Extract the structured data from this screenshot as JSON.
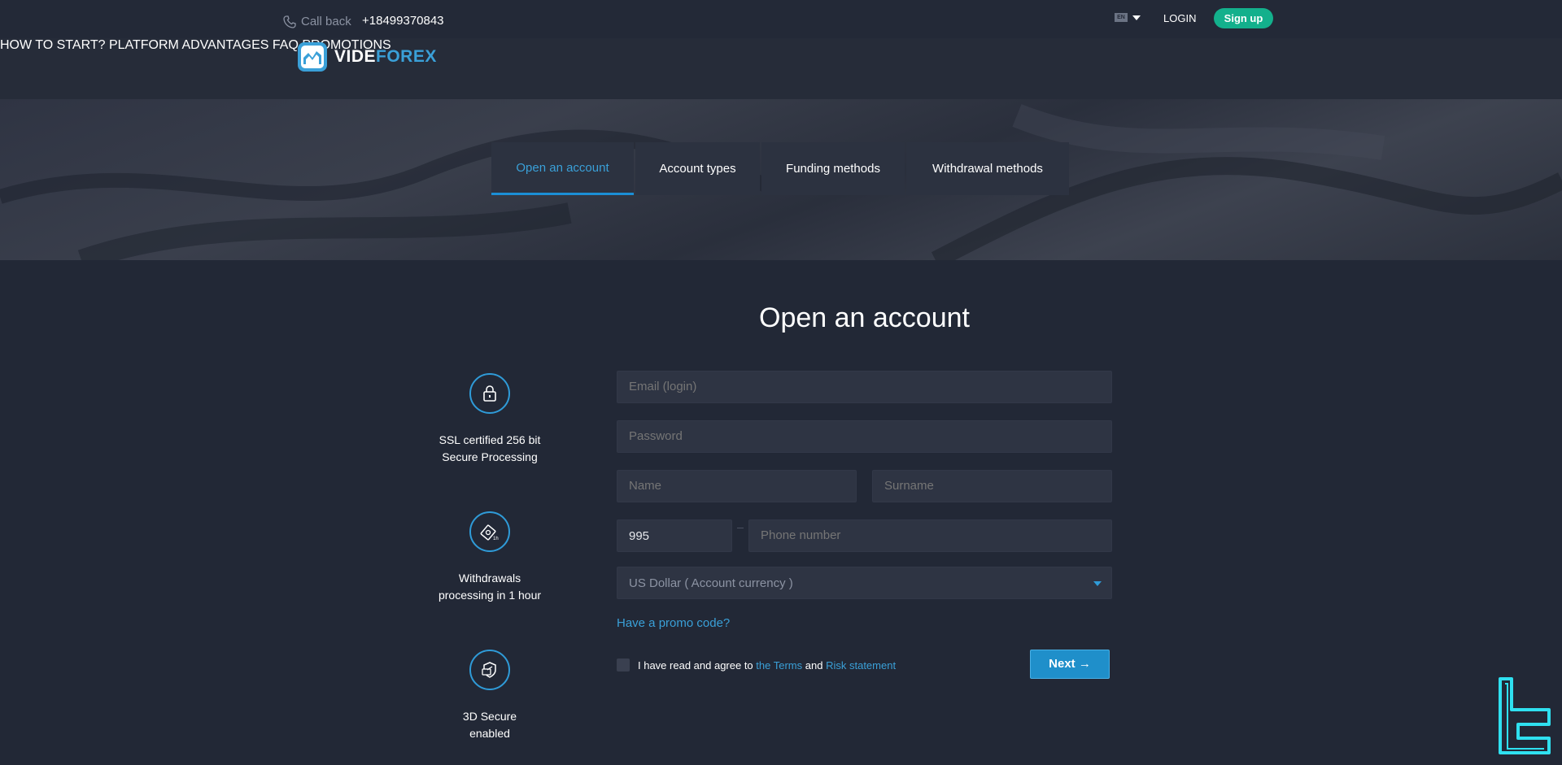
{
  "topbar": {
    "callback_label": "Call back",
    "phone": "+18499370843",
    "language_code": "EN",
    "login_label": "LOGIN",
    "signup_label": "Sign up"
  },
  "header": {
    "logo_text_a": "VIDE",
    "logo_text_b": "FOREX",
    "nav": [
      "HOW TO START?",
      "PLATFORM",
      "ADVANTAGES",
      "FAQ",
      "PROMOTIONS"
    ]
  },
  "tabs": [
    "Open an account",
    "Account types",
    "Funding methods",
    "Withdrawal methods"
  ],
  "form": {
    "title": "Open an account",
    "email_placeholder": "Email (login)",
    "password_placeholder": "Password",
    "name_placeholder": "Name",
    "surname_placeholder": "Surname",
    "phone_code_value": "995",
    "phone_placeholder": "Phone number",
    "currency_selected": "US Dollar ( Account currency )",
    "promo_link": "Have a promo code?",
    "agree_text": "I have read and agree to",
    "terms_link": "the Terms",
    "and_text": "and",
    "risk_link": "Risk statement",
    "next_label": "Next →"
  },
  "features": [
    {
      "icon": "lock-icon",
      "line1": "SSL certified 256 bit",
      "line2": "Secure Processing"
    },
    {
      "icon": "money-clock-icon",
      "line1": "Withdrawals",
      "line2": "processing in 1 hour"
    },
    {
      "icon": "shield-card-icon",
      "line1": "3D Secure",
      "line2": "enabled"
    }
  ],
  "colors": {
    "accent": "#1f8fca",
    "link": "#3aa0d8",
    "signup": "#13b08c",
    "background": "#222836",
    "field": "#2e3443"
  }
}
